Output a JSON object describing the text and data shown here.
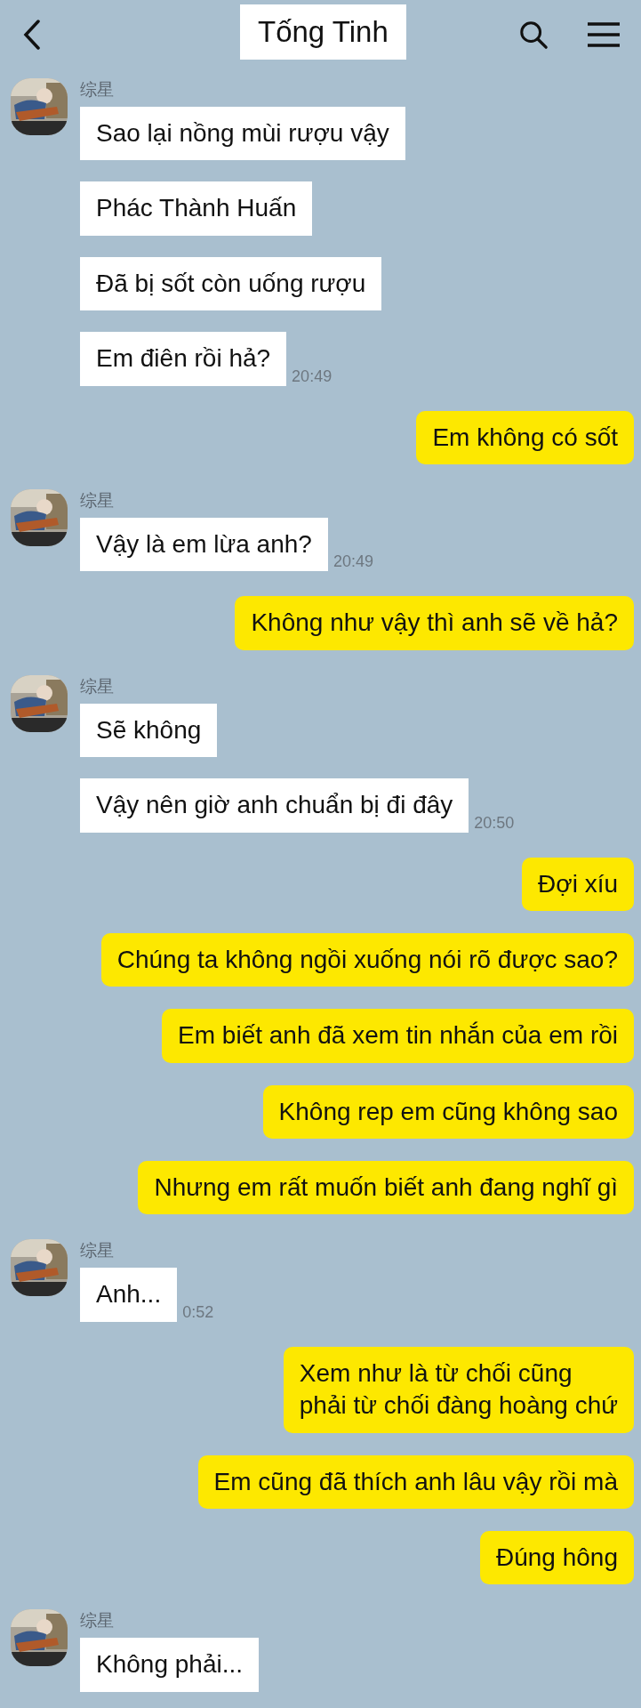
{
  "header": {
    "title": "Tống Tinh"
  },
  "messages": [
    {
      "kind": "incoming",
      "sender": "综星",
      "bubbles": [
        "Sao lại nồng mùi rượu vậy",
        "Phác Thành Huấn",
        "Đã bị sốt còn uống rượu",
        "Em điên rồi hả?"
      ],
      "time": "20:49"
    },
    {
      "kind": "outgoing",
      "bubbles": [
        "Em không có sốt"
      ]
    },
    {
      "kind": "incoming",
      "sender": "综星",
      "bubbles": [
        "Vậy là em lừa anh?"
      ],
      "time": "20:49"
    },
    {
      "kind": "outgoing",
      "bubbles": [
        "Không như vậy thì anh sẽ về hả?"
      ]
    },
    {
      "kind": "incoming",
      "sender": "综星",
      "bubbles": [
        "Sẽ không",
        "Vậy nên giờ anh chuẩn bị đi đây"
      ],
      "time": "20:50"
    },
    {
      "kind": "outgoing",
      "bubbles": [
        "Đợi xíu",
        "Chúng ta không ngồi xuống nói rõ được sao?",
        "Em biết anh đã xem tin nhắn của em rồi",
        "Không rep em cũng không sao",
        "Nhưng em rất muốn biết anh đang nghĩ gì"
      ]
    },
    {
      "kind": "incoming",
      "sender": "综星",
      "bubbles": [
        "Anh..."
      ],
      "time": "0:52"
    },
    {
      "kind": "outgoing",
      "bubbles": [
        "Xem như là từ chối cũng\nphải từ chối đàng hoàng chứ",
        "Em cũng đã thích anh lâu vậy rồi mà",
        "Đúng hông"
      ]
    },
    {
      "kind": "incoming",
      "sender": "综星",
      "bubbles": [
        "Không phải..."
      ]
    }
  ]
}
